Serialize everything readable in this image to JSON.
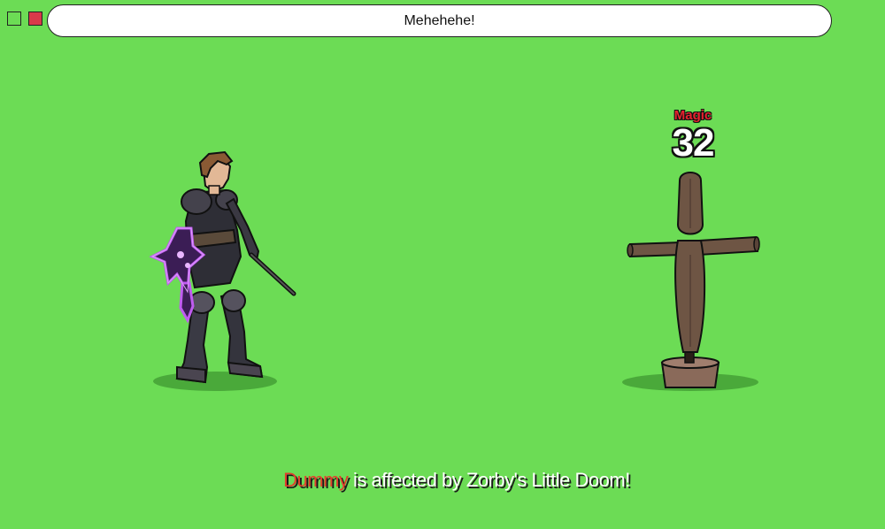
{
  "chat": {
    "text": "Mehehehe!"
  },
  "window_buttons": [
    {
      "name": "green-square-button",
      "color": "#6cdc55"
    },
    {
      "name": "red-square-button",
      "color": "#d8394a"
    }
  ],
  "damage": {
    "type": "Magic",
    "value": "32",
    "type_color": "#e8232f"
  },
  "combat_message": {
    "target": "Dummy",
    "text": " is affected by Zorby's Little Doom!",
    "target_color": "#e23d2c"
  },
  "background_color": "#6cdc55"
}
